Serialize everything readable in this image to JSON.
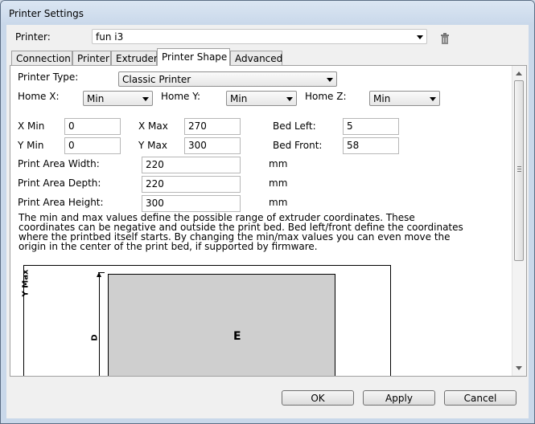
{
  "window": {
    "title": "Printer Settings"
  },
  "printer": {
    "label": "Printer:",
    "selected": "fun i3"
  },
  "tabs": [
    "Connection",
    "Printer",
    "Extruder",
    "Printer Shape",
    "Advanced"
  ],
  "shape": {
    "printer_type_label": "Printer Type:",
    "printer_type_value": "Classic Printer",
    "home_x_label": "Home X:",
    "home_x_value": "Min",
    "home_y_label": "Home Y:",
    "home_y_value": "Min",
    "home_z_label": "Home Z:",
    "home_z_value": "Min",
    "x_min_label": "X Min",
    "x_min_value": "0",
    "x_max_label": "X Max",
    "x_max_value": "270",
    "bed_left_label": "Bed Left:",
    "bed_left_value": "5",
    "y_min_label": "Y Min",
    "y_min_value": "0",
    "y_max_label": "Y Max",
    "y_max_value": "300",
    "bed_front_label": "Bed Front:",
    "bed_front_value": "58",
    "width_label": "Print Area Width:",
    "width_value": "220",
    "depth_label": "Print Area Depth:",
    "depth_value": "220",
    "height_label": "Print Area Height:",
    "height_value": "300",
    "unit": "mm",
    "description": [
      "The min and max values define the possible range of extruder coordinates. These",
      "coordinates can be negative and outside the print bed. Bed left/front define the coordinates",
      "where the printbed itself starts. By changing the min/max values you can even move the",
      "origin in the center of the print bed, if supported by firmware."
    ]
  },
  "diagram": {
    "y_max_label": "Y Max",
    "d_label": "D",
    "e_label": "E"
  },
  "buttons": {
    "ok": "OK",
    "apply": "Apply",
    "cancel": "Cancel"
  }
}
